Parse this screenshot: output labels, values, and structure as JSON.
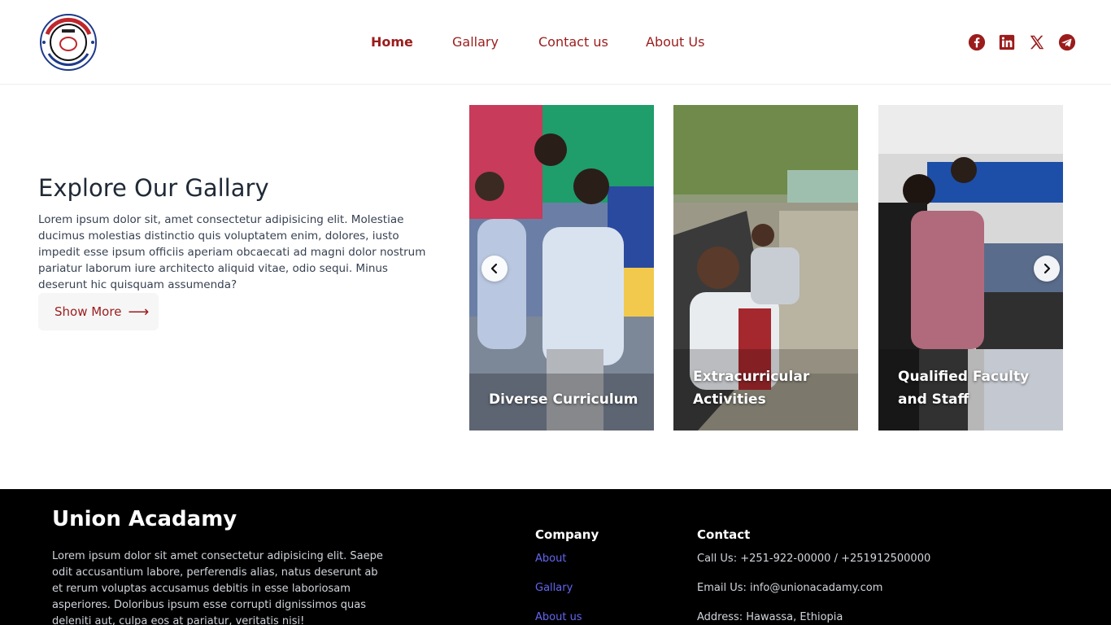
{
  "header": {
    "logo_alt": "Union Academy",
    "nav": [
      "Home",
      "Gallary",
      "Contact us",
      "About Us"
    ],
    "social": [
      "facebook-icon",
      "linkedin-icon",
      "x-icon",
      "telegram-icon"
    ]
  },
  "intro": {
    "title": "Explore Our Gallary",
    "text": "Lorem ipsum dolor sit, amet consectetur adipisicing elit. Molestiae ducimus molestias distinctio quis voluptatem enim, dolores, iusto impedit esse ipsum officiis aperiam obcaecati ad magni dolor nostrum pariatur laborum iure architecto aliquid vitae, odio sequi. Minus deserunt hic quisquam assumenda?",
    "button": "Show More"
  },
  "gallery": {
    "cards": [
      "Diverse Curriculum",
      "Extracurricular Activities",
      "Qualified Faculty and Staff"
    ]
  },
  "footer": {
    "title": "Union Acadamy",
    "text": "Lorem ipsum dolor sit amet consectetur adipisicing elit. Saepe odit accusantium labore, perferendis alias, natus deserunt ab et rerum voluptas accusamus debitis in esse laboriosam asperiores. Doloribus ipsum esse corrupti dignissimos quas deleniti aut, culpa eos at pariatur, veritatis nisi!",
    "company_heading": "Company",
    "company_links": [
      "About",
      "Gallary",
      "About us"
    ],
    "contact_heading": "Contact",
    "contact_lines": [
      "Call Us: +251-922-00000 / +251912500000",
      "Email Us: info@unionacadamy.com",
      "Address: Hawassa, Ethiopia"
    ]
  },
  "colors": {
    "brand": "#9b1c1c",
    "footer_bg": "#000000",
    "link": "#6366f1"
  }
}
